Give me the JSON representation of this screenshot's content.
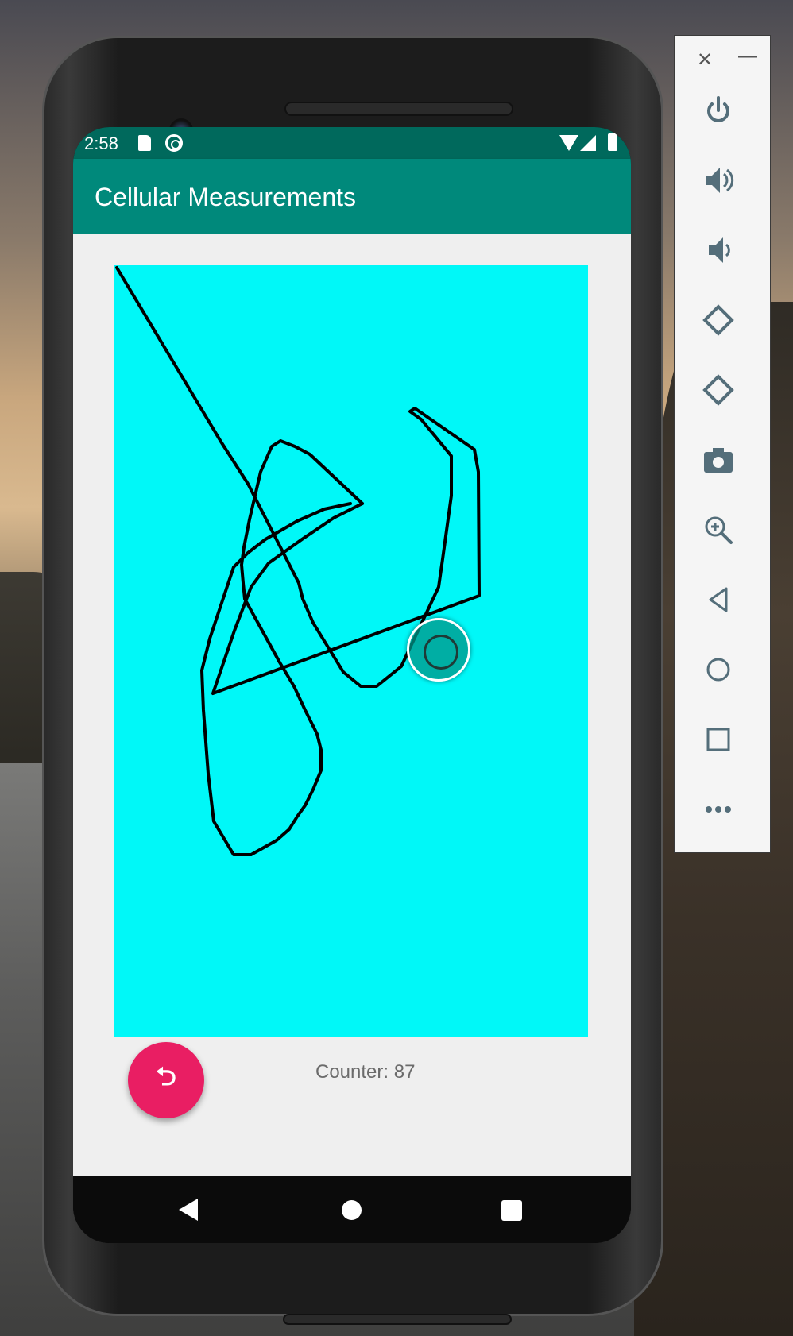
{
  "status_bar": {
    "time": "2:58",
    "icons": [
      "sd-card-icon",
      "sync-icon",
      "wifi-icon",
      "signal-icon",
      "battery-icon"
    ]
  },
  "app_bar": {
    "title": "Cellular Measurements"
  },
  "canvas": {
    "background_color": "#00f8f8",
    "stroke_color": "#000000"
  },
  "counter": {
    "text": "Counter: 87"
  },
  "fab": {
    "icon": "undo-icon",
    "color": "#e91e63"
  },
  "navigation": {
    "items": [
      "back-icon",
      "home-icon",
      "recents-icon"
    ]
  },
  "emulator_toolbar": {
    "window_controls": [
      "close-icon",
      "minimize-icon"
    ],
    "close_glyph": "✕",
    "minimize_glyph": "—",
    "buttons": [
      "power-icon",
      "volume-up-icon",
      "volume-down-icon",
      "rotate-left-icon",
      "rotate-right-icon",
      "screenshot-icon",
      "zoom-icon",
      "back-icon",
      "home-icon",
      "overview-icon",
      "more-icon"
    ]
  }
}
